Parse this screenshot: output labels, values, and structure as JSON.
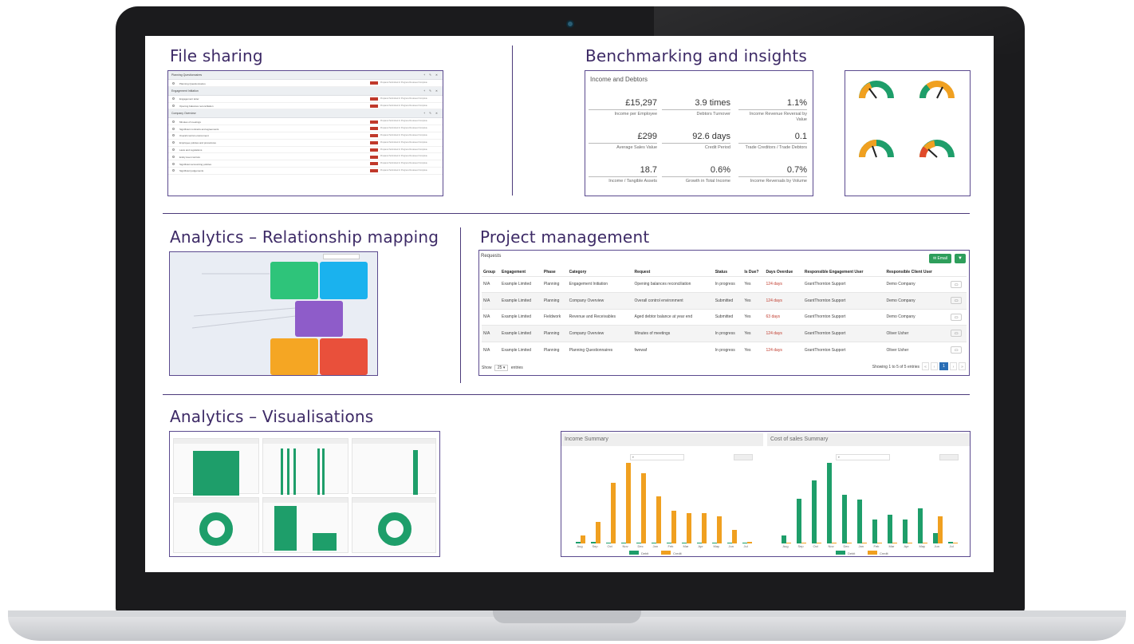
{
  "sections": {
    "file_sharing": "File sharing",
    "benchmarking": "Benchmarking and insights",
    "relationship": "Analytics – Relationship mapping",
    "project": "Project management",
    "visualisations": "Analytics – Visualisations"
  },
  "benchmark": {
    "panel_title": "Income and Debtors",
    "kpis": [
      {
        "value": "£15,297",
        "label": "Income per Employee"
      },
      {
        "value": "3.9 times",
        "label": "Debtors Turnover"
      },
      {
        "value": "1.1%",
        "label": "Income Revenue Reversal by Value"
      },
      {
        "value": "£299",
        "label": "Average Sales Value"
      },
      {
        "value": "92.6 days",
        "label": "Credit Period"
      },
      {
        "value": "0.1",
        "label": "Trade Creditors / Trade Debtors"
      },
      {
        "value": "18.7",
        "label": "Income / Tangible Assets"
      },
      {
        "value": "0.6%",
        "label": "Growth in Total Income"
      },
      {
        "value": "0.7%",
        "label": "Income Reversals by Volume"
      }
    ]
  },
  "project": {
    "title": "Requests",
    "email_label": "Email",
    "columns": [
      "Group",
      "Engagement",
      "Phase",
      "Category",
      "Request",
      "Status",
      "Is Due?",
      "Days Overdue",
      "Responsible Engagement User",
      "Responsible Client User"
    ],
    "rows": [
      [
        "N/A",
        "Example Limited",
        "Planning",
        "Engagement Initiation",
        "Opening balances reconciliation",
        "In progress",
        "Yes",
        "124 days",
        "GrantThornton Support",
        "Demo Company"
      ],
      [
        "N/A",
        "Example Limited",
        "Planning",
        "Company Overview",
        "Overall control environment",
        "Submitted",
        "Yes",
        "124 days",
        "GrantThornton Support",
        "Demo Company"
      ],
      [
        "N/A",
        "Example Limited",
        "Fieldwork",
        "Revenue and Receivables",
        "Aged debtor balance at year end",
        "Submitted",
        "Yes",
        "63 days",
        "GrantThornton Support",
        "Demo Company"
      ],
      [
        "N/A",
        "Example Limited",
        "Planning",
        "Company Overview",
        "Minutes of meetings",
        "In progress",
        "Yes",
        "124 days",
        "GrantThornton Support",
        "Oliver Usher"
      ],
      [
        "N/A",
        "Example Limited",
        "Planning",
        "Planning Questionnaires",
        "fwewaf",
        "In progress",
        "Yes",
        "124 days",
        "GrantThornton Support",
        "Oliver Usher"
      ]
    ],
    "show_label": "Show",
    "page_size": "25",
    "entries_label": "entries",
    "showing": "Showing 1 to 5 of 5 entries",
    "page": "1"
  },
  "summaries": {
    "income_title": "Income Summary",
    "cost_title": "Cost of sales Summary",
    "legend_debit": "Debit",
    "legend_credit": "Credit",
    "months": [
      "Aug",
      "Sep",
      "Oct",
      "Nov",
      "Dec",
      "Jan",
      "Feb",
      "Mar",
      "Apr",
      "May",
      "Jun",
      "Jul"
    ]
  },
  "chart_data": [
    {
      "type": "bar",
      "title": "Income Summary",
      "categories": [
        "Aug",
        "Sep",
        "Oct",
        "Nov",
        "Dec",
        "Jan",
        "Feb",
        "Mar",
        "Apr",
        "May",
        "Jun",
        "Jul"
      ],
      "series": [
        {
          "name": "Debit",
          "values": [
            2,
            2,
            1,
            1,
            1,
            1,
            1,
            1,
            1,
            1,
            1,
            1
          ]
        },
        {
          "name": "Credit",
          "values": [
            10,
            28,
            79,
            105,
            92,
            61,
            43,
            40,
            40,
            35,
            18,
            2
          ]
        }
      ]
    },
    {
      "type": "bar",
      "title": "Cost of sales Summary",
      "categories": [
        "Aug",
        "Sep",
        "Oct",
        "Nov",
        "Dec",
        "Jan",
        "Feb",
        "Mar",
        "Apr",
        "May",
        "Jun",
        "Jul"
      ],
      "series": [
        {
          "name": "Debit",
          "values": [
            10,
            58,
            82,
            105,
            63,
            57,
            31,
            37,
            31,
            46,
            14,
            2
          ]
        },
        {
          "name": "Credit",
          "values": [
            1,
            1,
            1,
            1,
            1,
            1,
            1,
            1,
            1,
            1,
            35,
            1
          ]
        }
      ]
    }
  ]
}
